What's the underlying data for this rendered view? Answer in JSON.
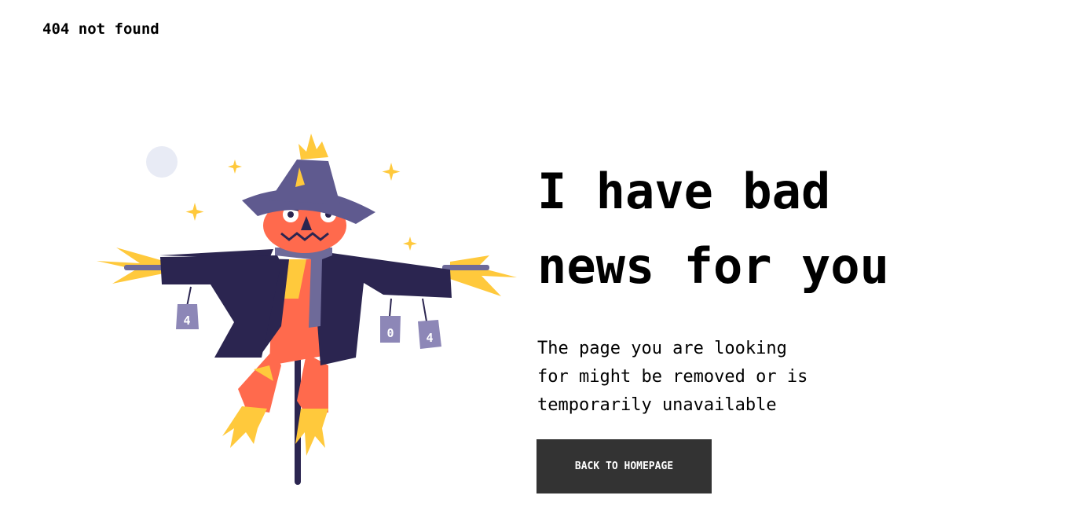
{
  "header": {
    "title": "404 not found"
  },
  "main": {
    "headline_line1": "I have bad",
    "headline_line2": "news for you",
    "message_line1": "The page you are looking",
    "message_line2": "for might be removed or is",
    "message_line3": "temporarily unavailable",
    "button_label": "BACK TO HOMEPAGE"
  },
  "illustration": {
    "subject": "scarecrow",
    "can_labels": [
      "4",
      "0",
      "4"
    ]
  },
  "colors": {
    "button_bg": "#333333",
    "button_text": "#ffffff",
    "hat": "#5f5a8f",
    "face": "#ff6a4d",
    "coat": "#2b2550",
    "straw": "#ffc93c",
    "scarf": "#6e6a99",
    "can": "#8d87b7",
    "moon": "#e8ebf5"
  }
}
